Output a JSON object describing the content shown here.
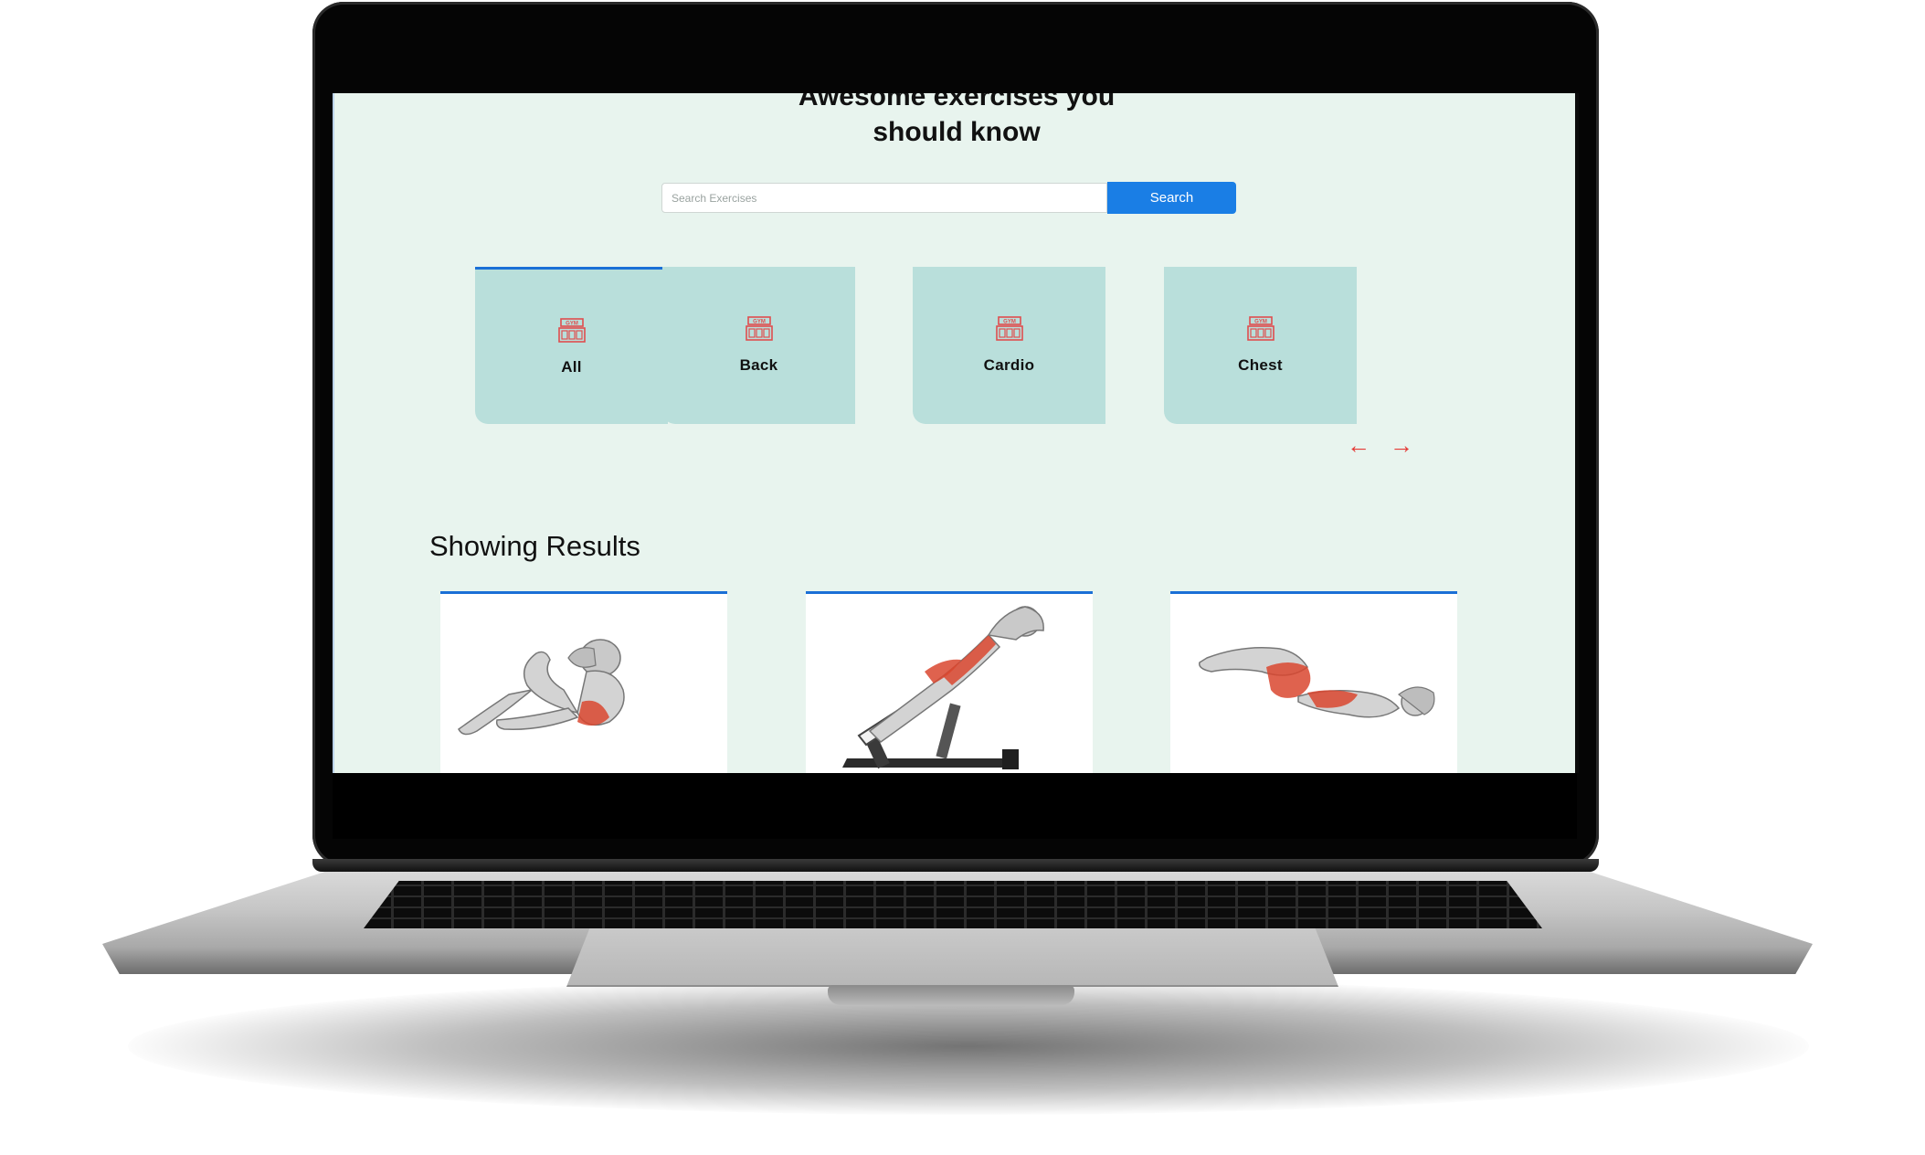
{
  "hero": {
    "title_line1": "Awesome exercises you",
    "title_line2": "should know"
  },
  "search": {
    "placeholder": "Search Exercises",
    "value": "",
    "button_label": "Search"
  },
  "body_parts": [
    {
      "label": "All",
      "icon": "gym-icon",
      "selected": true
    },
    {
      "label": "Back",
      "icon": "gym-icon",
      "selected": false
    },
    {
      "label": "Cardio",
      "icon": "gym-icon",
      "selected": false
    },
    {
      "label": "Chest",
      "icon": "gym-icon",
      "selected": false
    }
  ],
  "carousel": {
    "prev_symbol": "←",
    "next_symbol": "→",
    "arrow_color": "#e53935"
  },
  "results": {
    "heading": "Showing Results",
    "cards": [
      {
        "image": "crunch-exercise-illustration"
      },
      {
        "image": "back-extension-bench-illustration"
      },
      {
        "image": "leg-raise-crunch-illustration"
      }
    ]
  },
  "colors": {
    "page_bg": "#e8f4ee",
    "card_bg": "#b9dfdb",
    "accent_blue": "#1a7ee5",
    "highlight_muscle": "#d9472f"
  }
}
